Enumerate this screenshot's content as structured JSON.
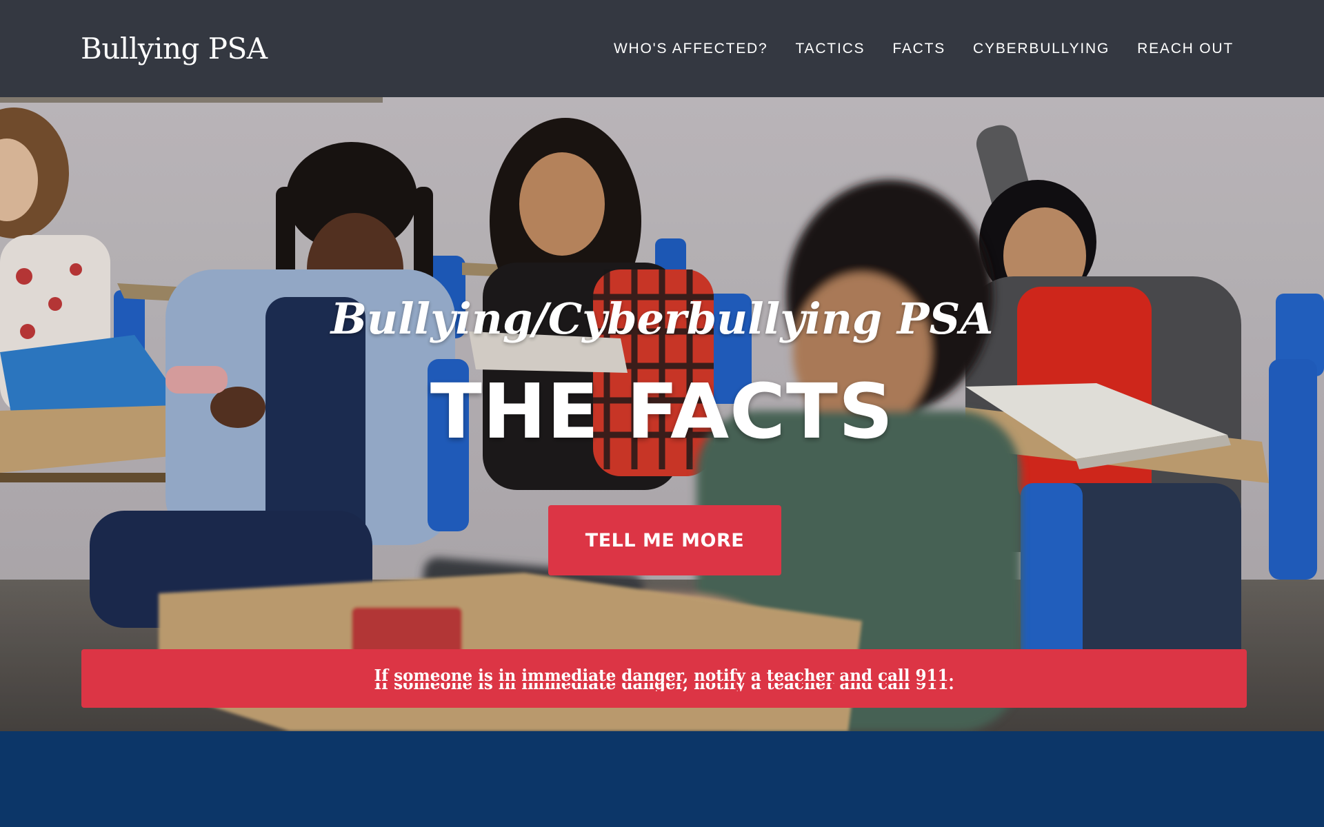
{
  "navbar": {
    "brand": "Bullying PSA",
    "links": [
      {
        "label": "WHO'S AFFECTED?"
      },
      {
        "label": "TACTICS"
      },
      {
        "label": "FACTS"
      },
      {
        "label": "CYBERBULLYING"
      },
      {
        "label": "REACH OUT"
      }
    ]
  },
  "hero": {
    "subtitle": "Bullying/Cyberbullying PSA",
    "title": "THE FACTS",
    "button_label": "TELL ME MORE",
    "photo_icon": "classroom-photo"
  },
  "alert": {
    "text": "If someone is in immediate danger, notify a teacher and call 911."
  },
  "colors": {
    "navbar_bg": "#343841",
    "accent_red": "#dc3545",
    "footer_blue": "#0c3668"
  }
}
